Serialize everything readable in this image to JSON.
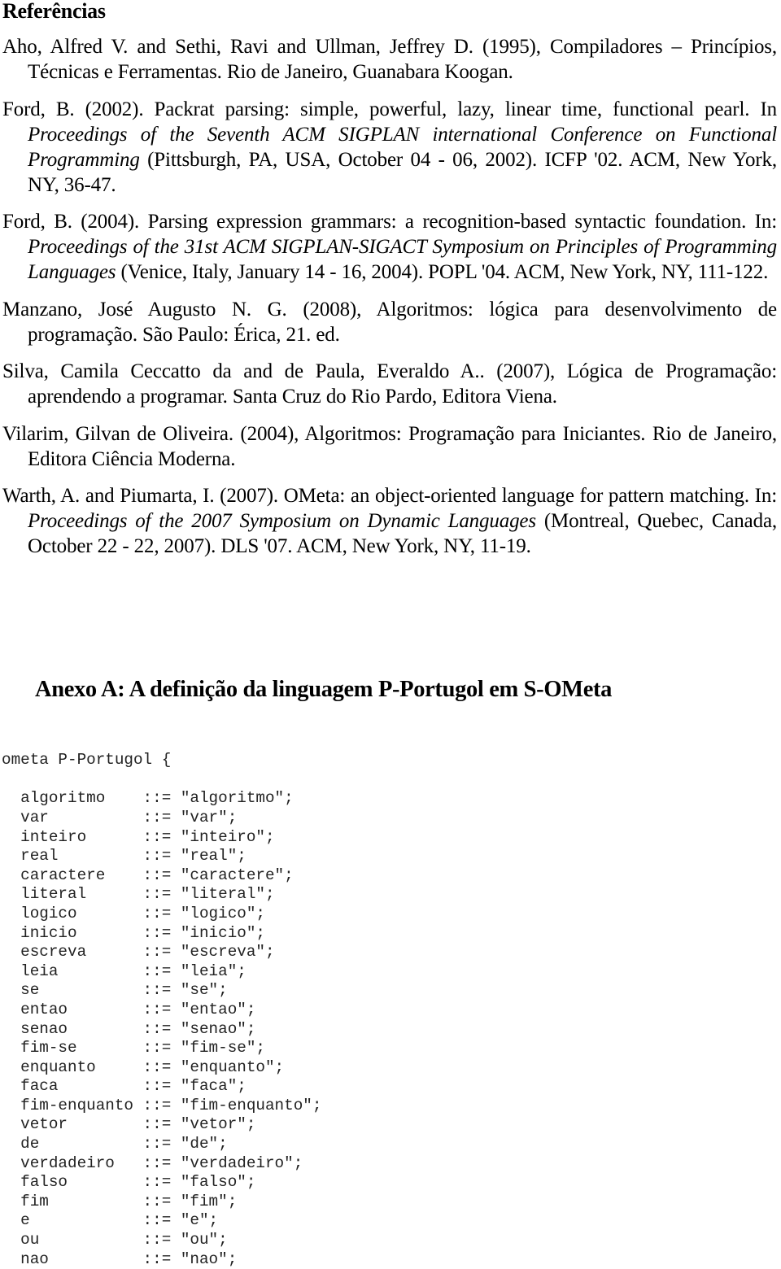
{
  "heading": "Referências",
  "references": [
    {
      "parts": [
        {
          "t": "Aho, Alfred V. and Sethi, Ravi and Ullman, Jeffrey D. (1995), Compiladores – Princípios, Técnicas e Ferramentas. Rio de Janeiro, Guanabara Koogan."
        }
      ]
    },
    {
      "parts": [
        {
          "t": "Ford, B. (2002). Packrat parsing: simple, powerful, lazy, linear time, functional pearl. In "
        },
        {
          "t": "Proceedings of the Seventh ACM SIGPLAN international Conference on Functional Programming",
          "i": true
        },
        {
          "t": " (Pittsburgh, PA, USA, October 04 - 06, 2002). ICFP '02. ACM, New York, NY, 36-47."
        }
      ]
    },
    {
      "parts": [
        {
          "t": "Ford, B. (2004). Parsing expression grammars: a recognition-based syntactic foundation. In: "
        },
        {
          "t": "Proceedings of the 31st ACM SIGPLAN-SIGACT Symposium on Principles of Programming Languages",
          "i": true
        },
        {
          "t": " (Venice, Italy, January 14 - 16, 2004). POPL '04. ACM, New York, NY, 111-122."
        }
      ]
    },
    {
      "parts": [
        {
          "t": "Manzano, José Augusto N. G. (2008), Algoritmos: lógica para desenvolvimento de programação. São Paulo: Érica, 21. ed."
        }
      ]
    },
    {
      "parts": [
        {
          "t": "Silva, Camila Ceccatto da and de Paula, Everaldo A.. (2007), Lógica de Programação: aprendendo a programar. Santa Cruz do Rio Pardo, Editora Viena."
        }
      ]
    },
    {
      "parts": [
        {
          "t": "Vilarim, Gilvan de Oliveira. (2004), Algoritmos: Programação para Iniciantes. Rio de Janeiro, Editora Ciência Moderna."
        }
      ]
    },
    {
      "parts": [
        {
          "t": "Warth, A. and Piumarta, I. (2007). OMeta: an object-oriented language for pattern matching. In: "
        },
        {
          "t": "Proceedings of the 2007 Symposium on Dynamic Languages",
          "i": true
        },
        {
          "t": " (Montreal, Quebec, Canada, October 22 - 22, 2007). DLS '07. ACM, New York, NY, 11-19."
        }
      ]
    }
  ],
  "annex_title": "Anexo A: A definição da linguagem P-Portugol em S-OMeta",
  "code": {
    "header": "ometa P-Portugol {",
    "rules": [
      {
        "name": "algoritmo",
        "value": "\"algoritmo\";"
      },
      {
        "name": "var",
        "value": "\"var\";"
      },
      {
        "name": "inteiro",
        "value": "\"inteiro\";"
      },
      {
        "name": "real",
        "value": "\"real\";"
      },
      {
        "name": "caractere",
        "value": "\"caractere\";"
      },
      {
        "name": "literal",
        "value": "\"literal\";"
      },
      {
        "name": "logico",
        "value": "\"logico\";"
      },
      {
        "name": "inicio",
        "value": "\"inicio\";"
      },
      {
        "name": "escreva",
        "value": "\"escreva\";"
      },
      {
        "name": "leia",
        "value": "\"leia\";"
      },
      {
        "name": "se",
        "value": "\"se\";"
      },
      {
        "name": "entao",
        "value": "\"entao\";"
      },
      {
        "name": "senao",
        "value": "\"senao\";"
      },
      {
        "name": "fim-se",
        "value": "\"fim-se\";"
      },
      {
        "name": "enquanto",
        "value": "\"enquanto\";"
      },
      {
        "name": "faca",
        "value": "\"faca\";"
      },
      {
        "name": "fim-enquanto",
        "value": "\"fim-enquanto\";"
      },
      {
        "name": "vetor",
        "value": "\"vetor\";"
      },
      {
        "name": "de",
        "value": "\"de\";"
      },
      {
        "name": "verdadeiro",
        "value": "\"verdadeiro\";"
      },
      {
        "name": "falso",
        "value": "\"falso\";"
      },
      {
        "name": "fim",
        "value": "\"fim\";"
      },
      {
        "name": "e",
        "value": "\"e\";"
      },
      {
        "name": "ou",
        "value": "\"ou\";"
      },
      {
        "name": "nao",
        "value": "\"nao\";"
      }
    ],
    "operator": "::="
  }
}
